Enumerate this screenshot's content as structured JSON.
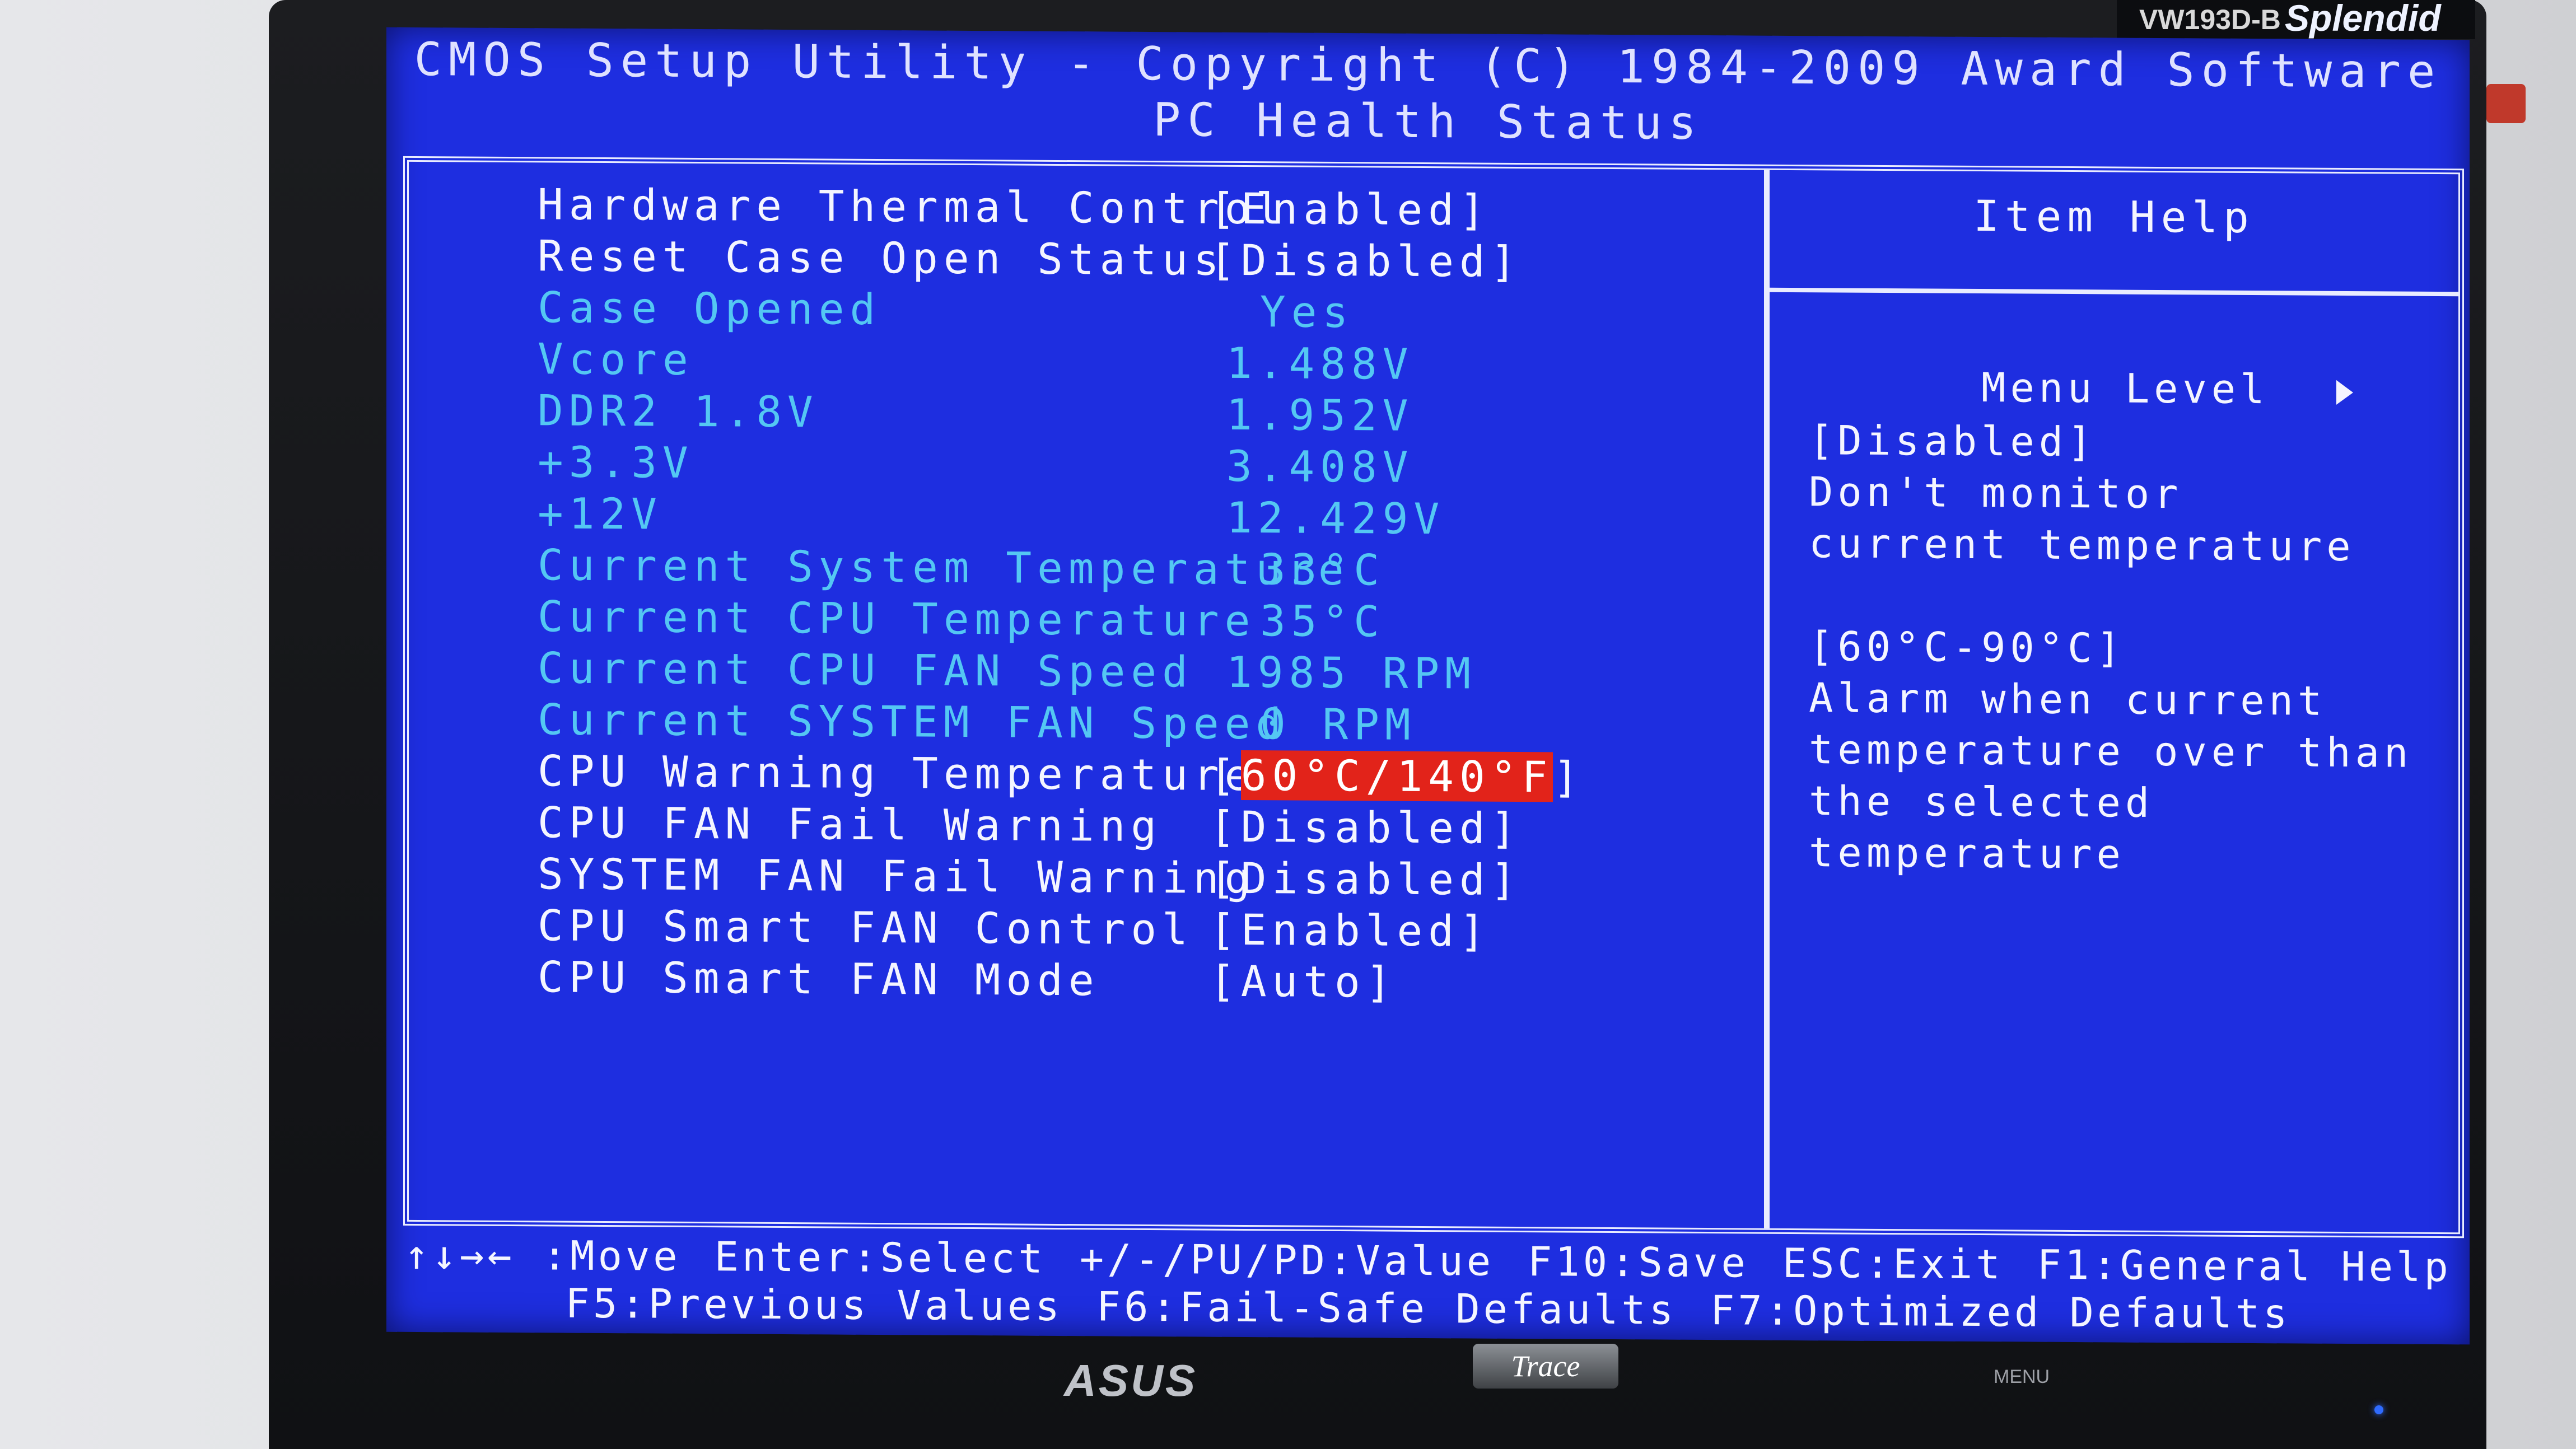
{
  "header": {
    "title": "CMOS Setup Utility - Copyright (C) 1984-2009 Award Software",
    "subtitle": "PC Health Status"
  },
  "settings": [
    {
      "label": "Hardware Thermal Control",
      "value": "[Enabled]",
      "state": "editable"
    },
    {
      "label": "Reset Case Open Status",
      "value": "[Disabled]",
      "state": "editable"
    },
    {
      "label": "Case Opened",
      "value": "Yes",
      "state": "readonly"
    },
    {
      "label": "Vcore",
      "value": "1.488V",
      "state": "readonly"
    },
    {
      "label": "DDR2 1.8V",
      "value": "1.952V",
      "state": "readonly"
    },
    {
      "label": "+3.3V",
      "value": "3.408V",
      "state": "readonly"
    },
    {
      "label": "+12V",
      "value": "12.429V",
      "state": "readonly"
    },
    {
      "label": "Current System Temperature",
      "value": "33°C",
      "state": "readonly"
    },
    {
      "label": "Current CPU Temperature",
      "value": "35°C",
      "state": "readonly"
    },
    {
      "label": "Current CPU FAN Speed",
      "value": "1985 RPM",
      "state": "readonly"
    },
    {
      "label": "Current SYSTEM FAN Speed",
      "value": "0 RPM",
      "state": "readonly"
    },
    {
      "label": "CPU Warning Temperature",
      "value": "60°C/140°F",
      "state": "selected"
    },
    {
      "label": "CPU FAN Fail Warning",
      "value": "[Disabled]",
      "state": "editable"
    },
    {
      "label": "SYSTEM FAN Fail Warning",
      "value": "[Disabled]",
      "state": "editable"
    },
    {
      "label": "CPU Smart FAN Control",
      "value": "[Enabled]",
      "state": "editable"
    },
    {
      "label": "CPU Smart FAN Mode",
      "value": "[Auto]",
      "state": "editable"
    }
  ],
  "help": {
    "title": "Item Help",
    "menu_level": "Menu Level",
    "lines": [
      "[Disabled]",
      "Don't monitor",
      "current temperature",
      "",
      "[60°C-90°C]",
      "Alarm when current",
      "temperature over than",
      "the selected",
      "temperature"
    ]
  },
  "footer": {
    "line1": [
      "↑↓→← :Move",
      "Enter:Select",
      "+/-/PU/PD:Value",
      "F10:Save",
      "ESC:Exit",
      "F1:General Help"
    ],
    "line2": [
      "F5:Previous Values",
      "F6:Fail-Safe Defaults",
      "F7:Optimized Defaults"
    ]
  },
  "monitor": {
    "model": "VW193D-B",
    "brand": "Splendid",
    "logo": "ASUS",
    "badge": "Trace",
    "buttons": [
      "MENU"
    ]
  },
  "colors": {
    "screen_bg": "#1e2ee0",
    "text_white": "#f4f5ff",
    "text_readonly": "#54c7f3",
    "highlight": "#e2231a"
  },
  "icons": [
    "up-down-arrows-icon",
    "menu-level-arrow-icon",
    "power-led-icon"
  ]
}
